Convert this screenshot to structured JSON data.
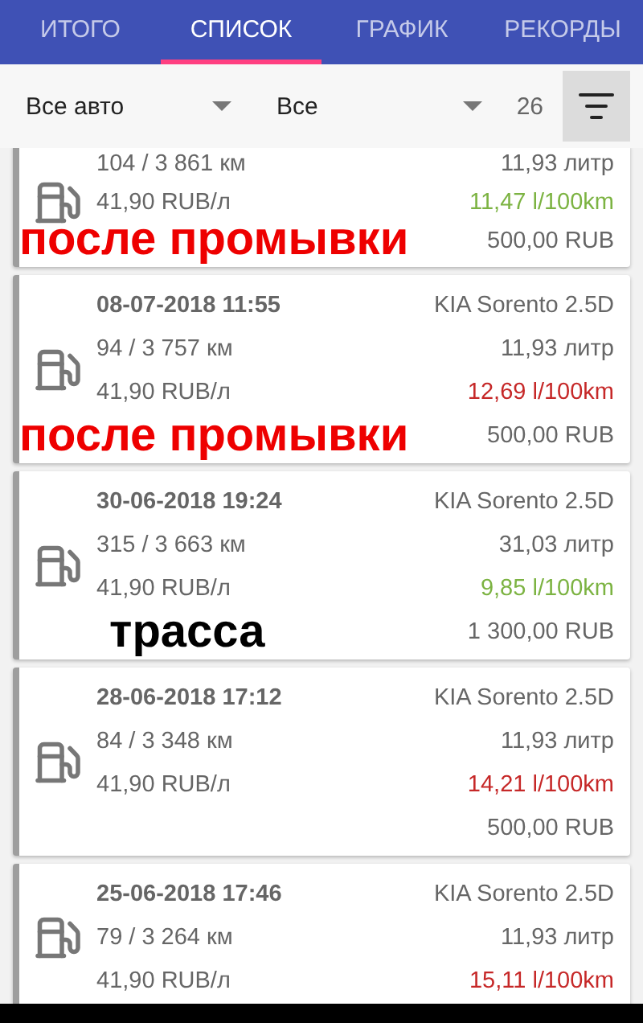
{
  "tabs": [
    {
      "label": "ИТОГО",
      "selected": false
    },
    {
      "label": "СПИСОК",
      "selected": true
    },
    {
      "label": "ГРАФИК",
      "selected": false
    },
    {
      "label": "РЕКОРДЫ",
      "selected": false
    }
  ],
  "filters": {
    "car": "Все авто",
    "type": "Все",
    "count": "26"
  },
  "entries": [
    {
      "distance": "104 / 3 861 км",
      "volume": "11,93 литр",
      "price": "41,90 RUB/л",
      "consumption": "11,47 l/100km",
      "color": "#7cb342",
      "total": "500,00 RUB",
      "note": {
        "text": "после промывки",
        "color": "#ee0000"
      }
    },
    {
      "date": "08-07-2018 11:55",
      "car": "KIA Sorento 2.5D",
      "distance": "94 / 3 757 км",
      "volume": "11,93 литр",
      "price": "41,90 RUB/л",
      "consumption": "12,69 l/100km",
      "color": "#c62828",
      "total": "500,00 RUB",
      "note": {
        "text": "после промывки",
        "color": "#ee0000"
      }
    },
    {
      "date": "30-06-2018 19:24",
      "car": "KIA Sorento 2.5D",
      "distance": "315 / 3 663 км",
      "volume": "31,03 литр",
      "price": "41,90 RUB/л",
      "consumption": "9,85 l/100km",
      "color": "#7cb342",
      "total": "1 300,00 RUB",
      "note": {
        "text": "трасса",
        "color": "#000000"
      }
    },
    {
      "date": "28-06-2018 17:12",
      "car": "KIA Sorento 2.5D",
      "distance": "84 / 3 348 км",
      "volume": "11,93 литр",
      "price": "41,90 RUB/л",
      "consumption": "14,21 l/100km",
      "color": "#c62828",
      "total": "500,00 RUB"
    },
    {
      "date": "25-06-2018 17:46",
      "car": "KIA Sorento 2.5D",
      "distance": "79 / 3 264 км",
      "volume": "11,93 литр",
      "price": "41,90 RUB/л",
      "consumption": "15,11 l/100km",
      "color": "#c62828"
    }
  ]
}
